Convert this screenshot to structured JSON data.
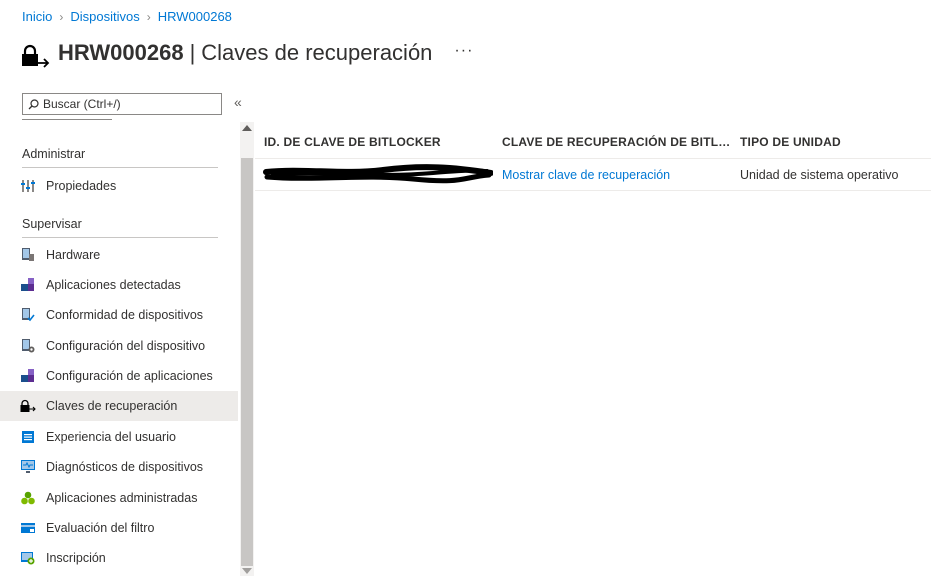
{
  "breadcrumb": [
    "Inicio",
    "Dispositivos",
    "HRW000268"
  ],
  "header": {
    "device": "HRW000268",
    "separator": "|",
    "page": "Claves de recuperación",
    "more": "···"
  },
  "search": {
    "placeholder": "Buscar (Ctrl+/)"
  },
  "collapse_glyph": "«",
  "sidebar": {
    "sections": [
      {
        "title": "Administrar",
        "items": [
          {
            "label": "Propiedades",
            "icon": "properties-icon"
          }
        ]
      },
      {
        "title": "Supervisar",
        "items": [
          {
            "label": "Hardware",
            "icon": "hardware-icon"
          },
          {
            "label": "Aplicaciones detectadas",
            "icon": "discovered-apps-icon"
          },
          {
            "label": "Conformidad de dispositivos",
            "icon": "device-compliance-icon"
          },
          {
            "label": "Configuración del dispositivo",
            "icon": "device-configuration-icon"
          },
          {
            "label": "Configuración de aplicaciones",
            "icon": "app-configuration-icon"
          },
          {
            "label": "Claves de recuperación",
            "icon": "recovery-keys-icon",
            "active": true
          },
          {
            "label": "Experiencia del usuario",
            "icon": "user-experience-icon"
          },
          {
            "label": "Diagnósticos de dispositivos",
            "icon": "device-diagnostics-icon"
          },
          {
            "label": "Aplicaciones administradas",
            "icon": "managed-apps-icon"
          },
          {
            "label": "Evaluación del filtro",
            "icon": "filter-evaluation-icon"
          },
          {
            "label": "Inscripción",
            "icon": "enrollment-icon"
          }
        ]
      }
    ]
  },
  "table": {
    "columns": [
      "ID. DE CLAVE DE BITLOCKER",
      "CLAVE DE RECUPERACIÓN DE BITLOCKER",
      "TIPO DE UNIDAD"
    ],
    "rows": [
      {
        "key_id": "",
        "key_id_redacted": true,
        "recovery_key": "Mostrar clave de recuperación",
        "drive_type": "Unidad de sistema operativo"
      }
    ]
  },
  "colors": {
    "link": "#0078d4",
    "active_bg": "#edebe9",
    "text": "#323130"
  }
}
